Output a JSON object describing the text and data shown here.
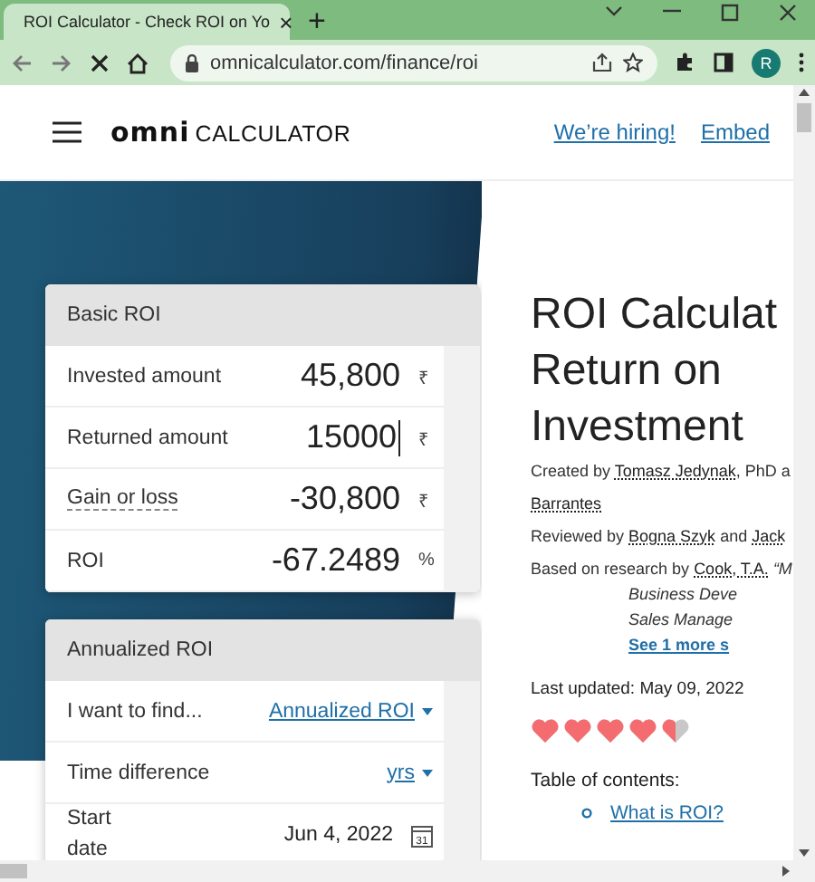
{
  "browser": {
    "tab_title": "ROI Calculator - Check ROI on Yo",
    "tab_close": "×",
    "new_tab": "+",
    "url": "omnicalculator.com/finance/roi",
    "profile_initial": "R"
  },
  "header": {
    "logo": "omni",
    "logo_word": "CALCULATOR",
    "links": [
      "We’re hiring!",
      "Embed"
    ]
  },
  "cards": [
    {
      "title": "Basic ROI",
      "rows": [
        {
          "kind": "input",
          "label": "Invested amount",
          "value": "45,800",
          "unit": "₹",
          "focused": false,
          "tooltip": false
        },
        {
          "kind": "input",
          "label": "Returned amount",
          "value": "15000",
          "unit": "₹",
          "focused": true,
          "tooltip": false
        },
        {
          "kind": "output",
          "label": "Gain or loss",
          "value": "-30,800",
          "unit": "₹",
          "tooltip": true
        },
        {
          "kind": "output",
          "label": "ROI",
          "value": "-67.2489",
          "unit": "%",
          "tooltip": false
        }
      ]
    },
    {
      "title": "Annualized ROI",
      "rows": [
        {
          "kind": "select",
          "label": "I want to find...",
          "value": "Annualized ROI"
        },
        {
          "kind": "select",
          "label": "Time difference",
          "value": "yrs"
        },
        {
          "kind": "date",
          "label": "Start date",
          "value": "Jun 4, 2022",
          "icon_text": "31"
        }
      ]
    }
  ],
  "article": {
    "title_lines": [
      "ROI Calculat",
      "Return on",
      "Investment"
    ],
    "credits": [
      [
        {
          "text": "Created by ",
          "link": false
        },
        {
          "text": "Tomasz Jedynak",
          "link": true
        },
        {
          "text": ", PhD a",
          "link": false
        }
      ],
      [
        {
          "text": "Barrantes",
          "link": true
        }
      ],
      [
        {
          "text": "Reviewed by ",
          "link": false
        },
        {
          "text": "Bogna Szyk",
          "link": true
        },
        {
          "text": " and ",
          "link": false
        },
        {
          "text": "Jack",
          "link": true
        }
      ]
    ],
    "research": {
      "lead": "Based on research by ",
      "author": "Cook, T.A.",
      "source_lines": [
        "“M",
        "Business Deve",
        "Sales Manage"
      ],
      "more": "See 1 more s"
    },
    "updated": "Last updated: May 09, 2022",
    "rating": {
      "stars": 4.5
    },
    "toc_title": "Table of contents:",
    "toc": [
      "What is ROI?"
    ]
  }
}
